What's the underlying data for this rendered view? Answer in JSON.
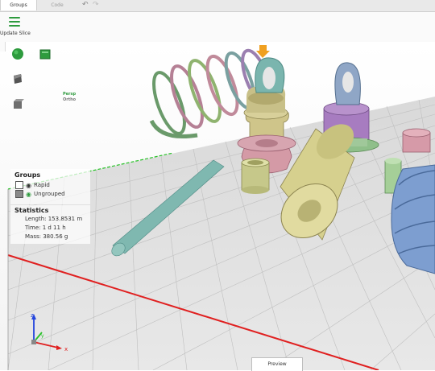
{
  "tabs": [
    {
      "label": "Groups",
      "active": true
    },
    {
      "label": "Code",
      "active": false
    }
  ],
  "toolbar": {
    "undo_icon": "undo-icon",
    "redo_icon": "redo-icon",
    "update_label": "Update Slice"
  },
  "view": {
    "persp_label": "Persp",
    "ortho_label": "Ortho"
  },
  "groups_panel": {
    "title": "Groups",
    "items": [
      {
        "label": "Rapid",
        "color": "#ffffff"
      },
      {
        "label": "Ungrouped",
        "color": "#8a8a8a"
      }
    ]
  },
  "statistics": {
    "title": "Statistics",
    "length": "Length: 153.8531 m",
    "time": "Time: 1 d 11 h",
    "mass": "Mass: 380.56 g"
  },
  "axes": {
    "x": "x",
    "y": "y",
    "z": "z"
  },
  "colors": {
    "accent_green": "#2e9b3e",
    "x_axis": "#e02020",
    "y_axis": "#26c026",
    "z_axis": "#2244dd",
    "marker": "#f0a020"
  },
  "bottom_tab": {
    "label": "Preview"
  }
}
